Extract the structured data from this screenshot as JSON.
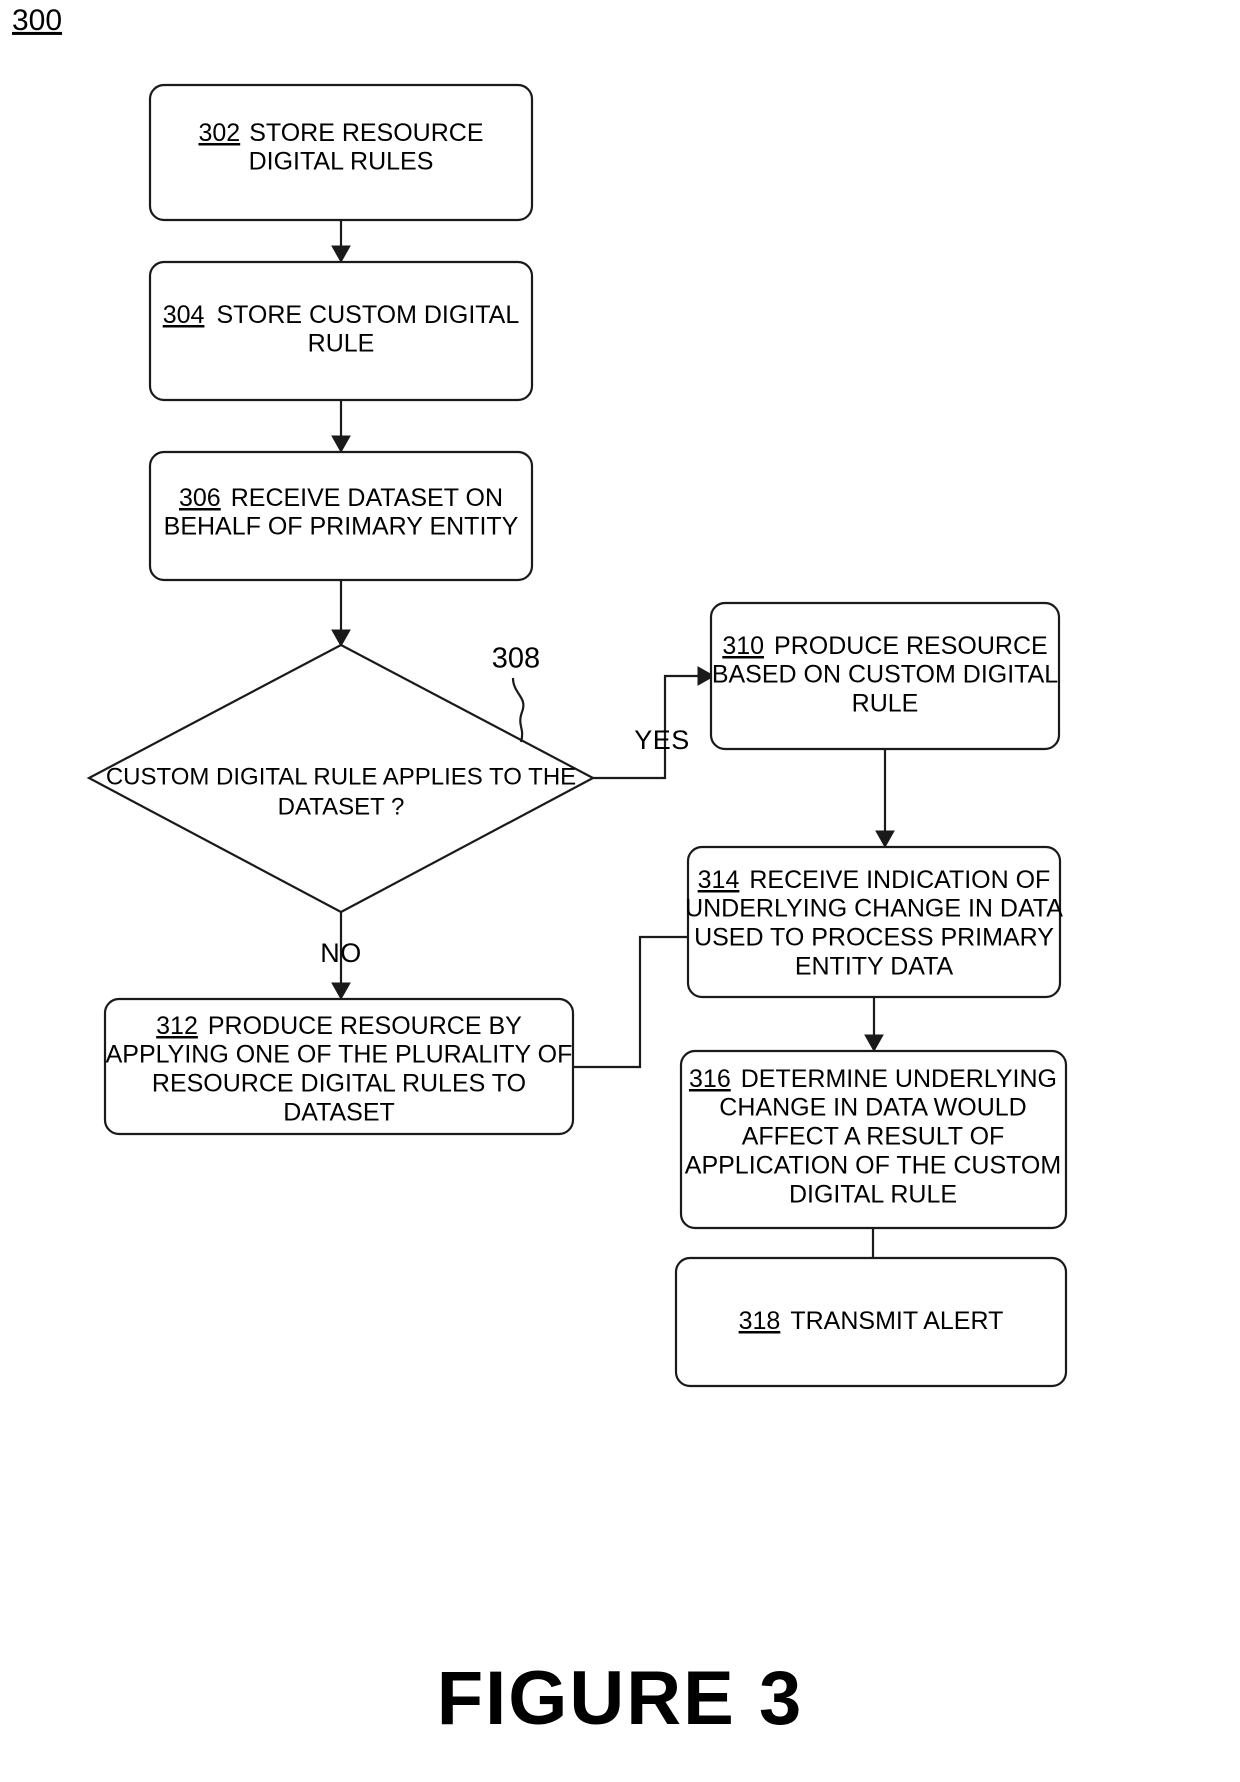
{
  "figure": {
    "number_label": "300",
    "caption": "FIGURE 3"
  },
  "nodes": [
    {
      "id": "302",
      "name": "store-resource-digital-rules",
      "ref": "302",
      "lines": [
        "STORE RESOURCE",
        "DIGITAL RULES"
      ],
      "shape": "process"
    },
    {
      "id": "304",
      "name": "store-custom-digital-rule",
      "ref": "304",
      "lines": [
        "STORE CUSTOM DIGITAL",
        "RULE"
      ],
      "shape": "process"
    },
    {
      "id": "306",
      "name": "receive-dataset-on-behalf-of-primary-entity",
      "ref": "306",
      "lines": [
        "RECEIVE DATASET ON",
        "BEHALF OF PRIMARY ENTITY"
      ],
      "shape": "process"
    },
    {
      "id": "308",
      "name": "custom-digital-rule-applies-decision",
      "ref": "308",
      "lines": [
        "CUSTOM DIGITAL RULE APPLIES TO THE",
        "DATASET ?"
      ],
      "shape": "decision"
    },
    {
      "id": "310",
      "name": "produce-resource-based-on-custom-digital-rule",
      "ref": "310",
      "lines": [
        "PRODUCE RESOURCE",
        "BASED ON CUSTOM DIGITAL",
        "RULE"
      ],
      "shape": "process"
    },
    {
      "id": "312",
      "name": "produce-resource-by-applying-resource-digital-rules",
      "ref": "312",
      "lines": [
        "PRODUCE RESOURCE BY",
        "APPLYING ONE OF THE PLURALITY OF",
        "RESOURCE DIGITAL RULES TO",
        "DATASET"
      ],
      "shape": "process"
    },
    {
      "id": "314",
      "name": "receive-indication-of-underlying-change-in-data",
      "ref": "314",
      "lines": [
        "RECEIVE INDICATION OF",
        "UNDERLYING CHANGE IN DATA",
        "USED TO PROCESS PRIMARY",
        "ENTITY DATA"
      ],
      "shape": "process"
    },
    {
      "id": "316",
      "name": "determine-underlying-change-affects-result",
      "ref": "316",
      "lines": [
        "DETERMINE UNDERLYING",
        "CHANGE IN DATA WOULD",
        "AFFECT A RESULT OF",
        "APPLICATION OF THE CUSTOM",
        "DIGITAL RULE"
      ],
      "shape": "process"
    },
    {
      "id": "318",
      "name": "transmit-alert",
      "ref": "318",
      "lines": [
        "TRANSMIT ALERT"
      ],
      "shape": "process"
    }
  ],
  "branch_labels": {
    "yes": "YES",
    "no": "NO"
  },
  "callouts": {
    "decision_callout": "308"
  },
  "colors": {
    "stroke": "#1a1a1a",
    "fill": "#ffffff",
    "text": "#000000"
  }
}
